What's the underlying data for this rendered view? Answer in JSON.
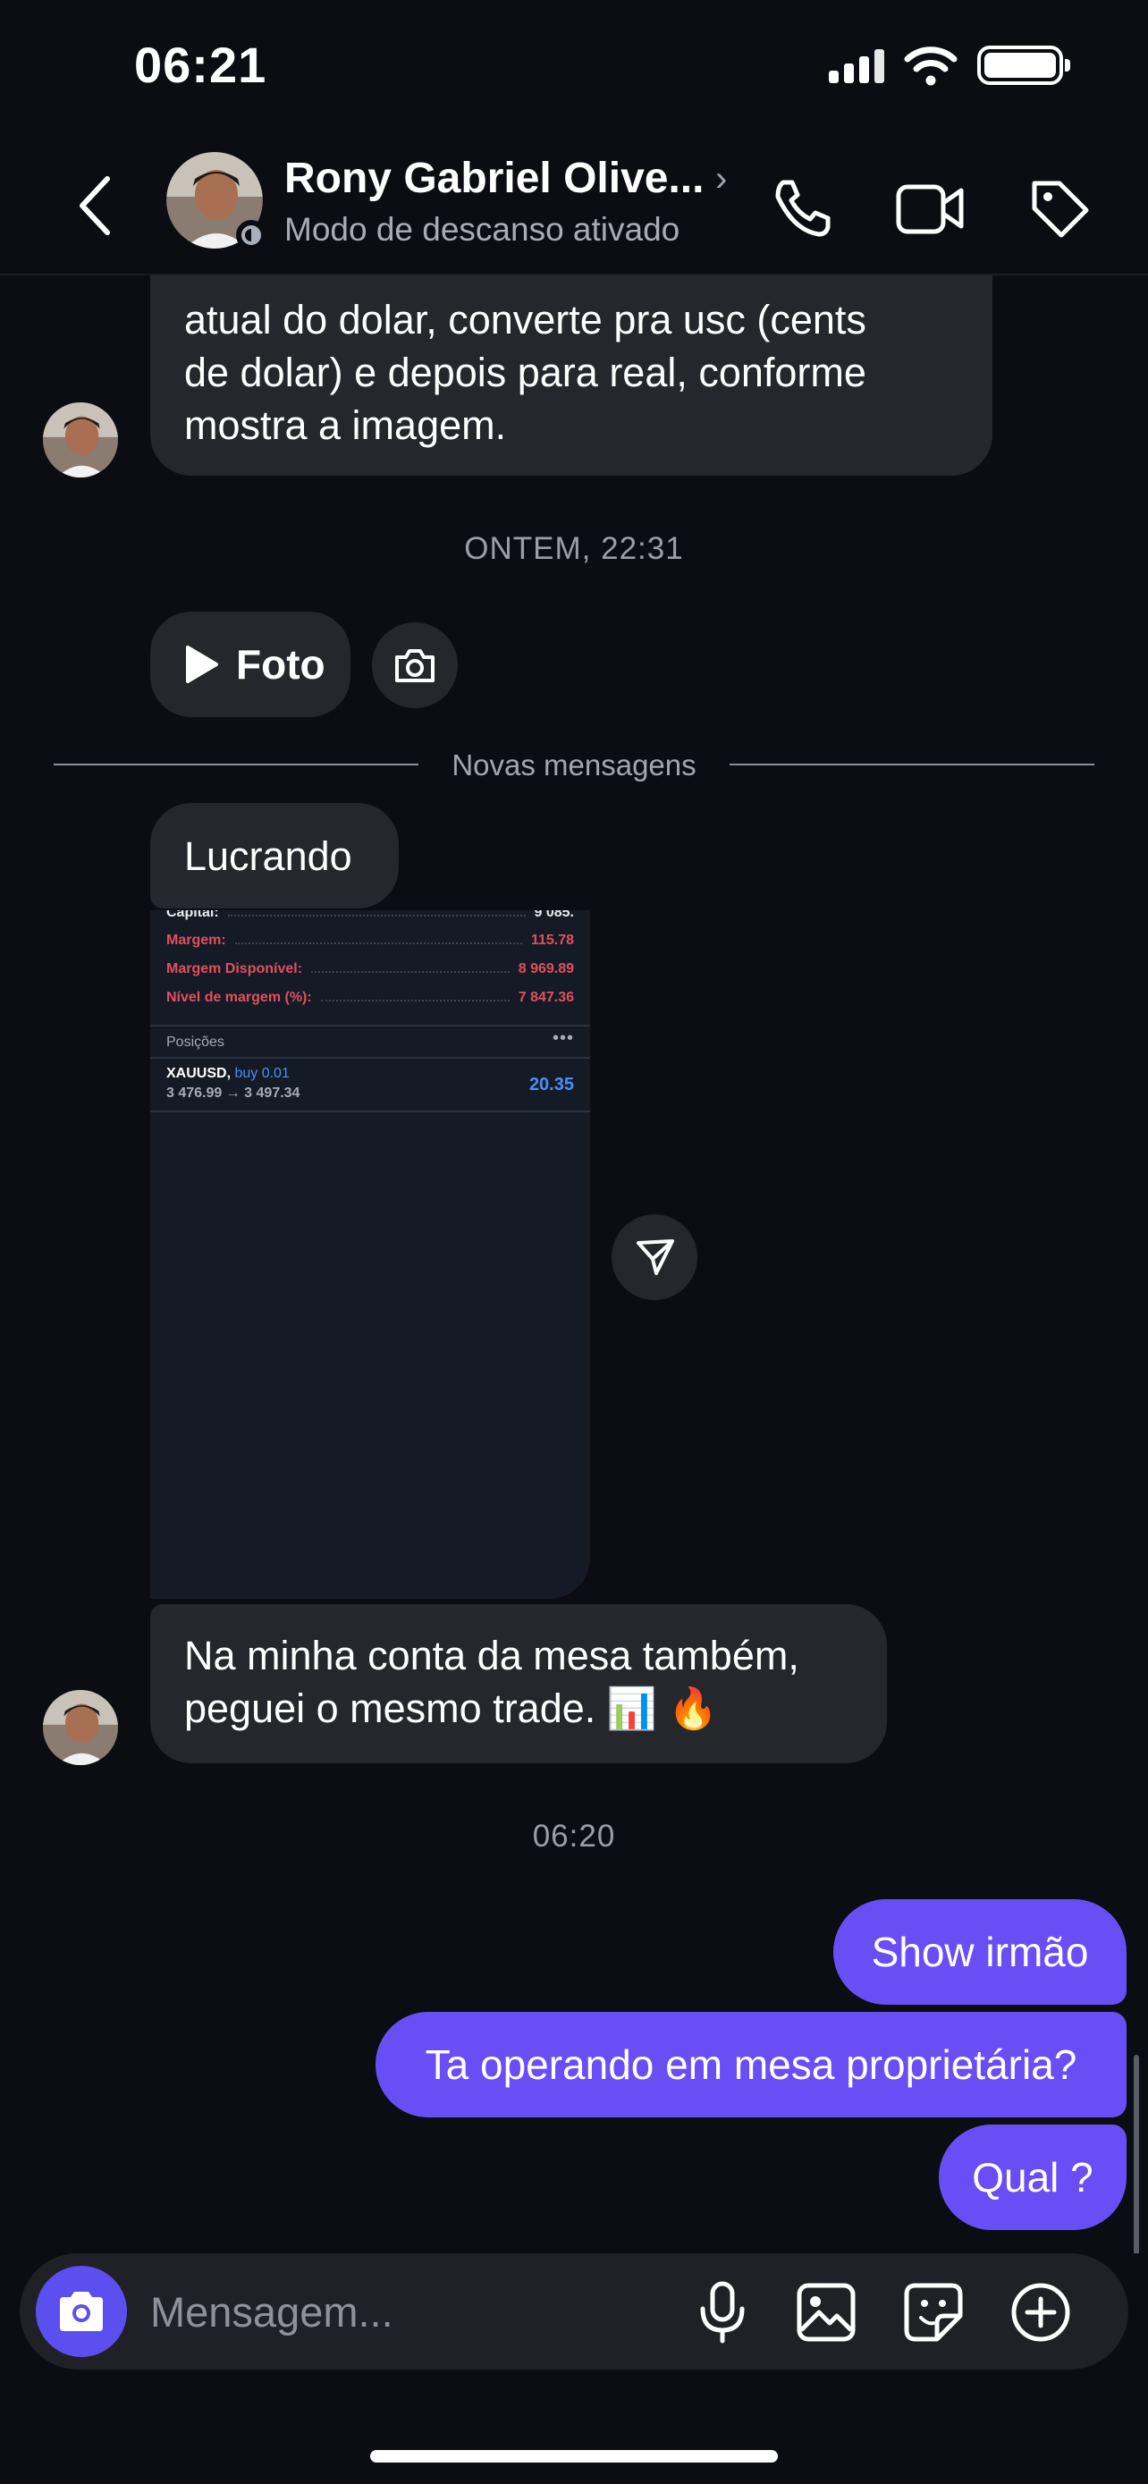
{
  "status_bar": {
    "time": "06:21"
  },
  "header": {
    "contact_name": "Rony Gabriel Olive...",
    "status": "Modo de descanso ativado"
  },
  "messages": {
    "first_bubble_partial_top": "...",
    "first_bubble_lines": [
      "atual do dolar, converte pra usc (cents",
      "de dolar) e depois para real, conforme",
      "mostra a imagem."
    ],
    "timestamp_1": "ONTEM, 22:31",
    "photo_label": "Foto",
    "new_messages_divider": "Novas mensagens",
    "lucrando": "Lucrando",
    "mesa_lines": [
      "Na minha conta da mesa também,",
      "peguei o mesmo trade. 📊 🔥"
    ],
    "timestamp_2": "06:20",
    "outgoing": [
      "Show irmão",
      "Ta operando em mesa proprietária?",
      "Qual ?"
    ]
  },
  "screenshot": {
    "partial_top_label": "Capital:",
    "partial_top_value": "9 085.",
    "rows": [
      {
        "label": "Margem:",
        "value": "115.78"
      },
      {
        "label": "Margem Disponível:",
        "value": "8 969.89"
      },
      {
        "label": "Nível de margem (%):",
        "value": "7 847.36"
      }
    ],
    "positions_label": "Posições",
    "positions_more": "•••",
    "symbol": "XAUUSD,",
    "side": "buy 0.01",
    "prices": "3 476.99 → 3 497.34",
    "profit": "20.35"
  },
  "composer": {
    "placeholder": "Mensagem..."
  },
  "colors": {
    "accent": "#6a4ef5",
    "incoming_bubble": "#25272d",
    "background": "#0c0d12"
  }
}
